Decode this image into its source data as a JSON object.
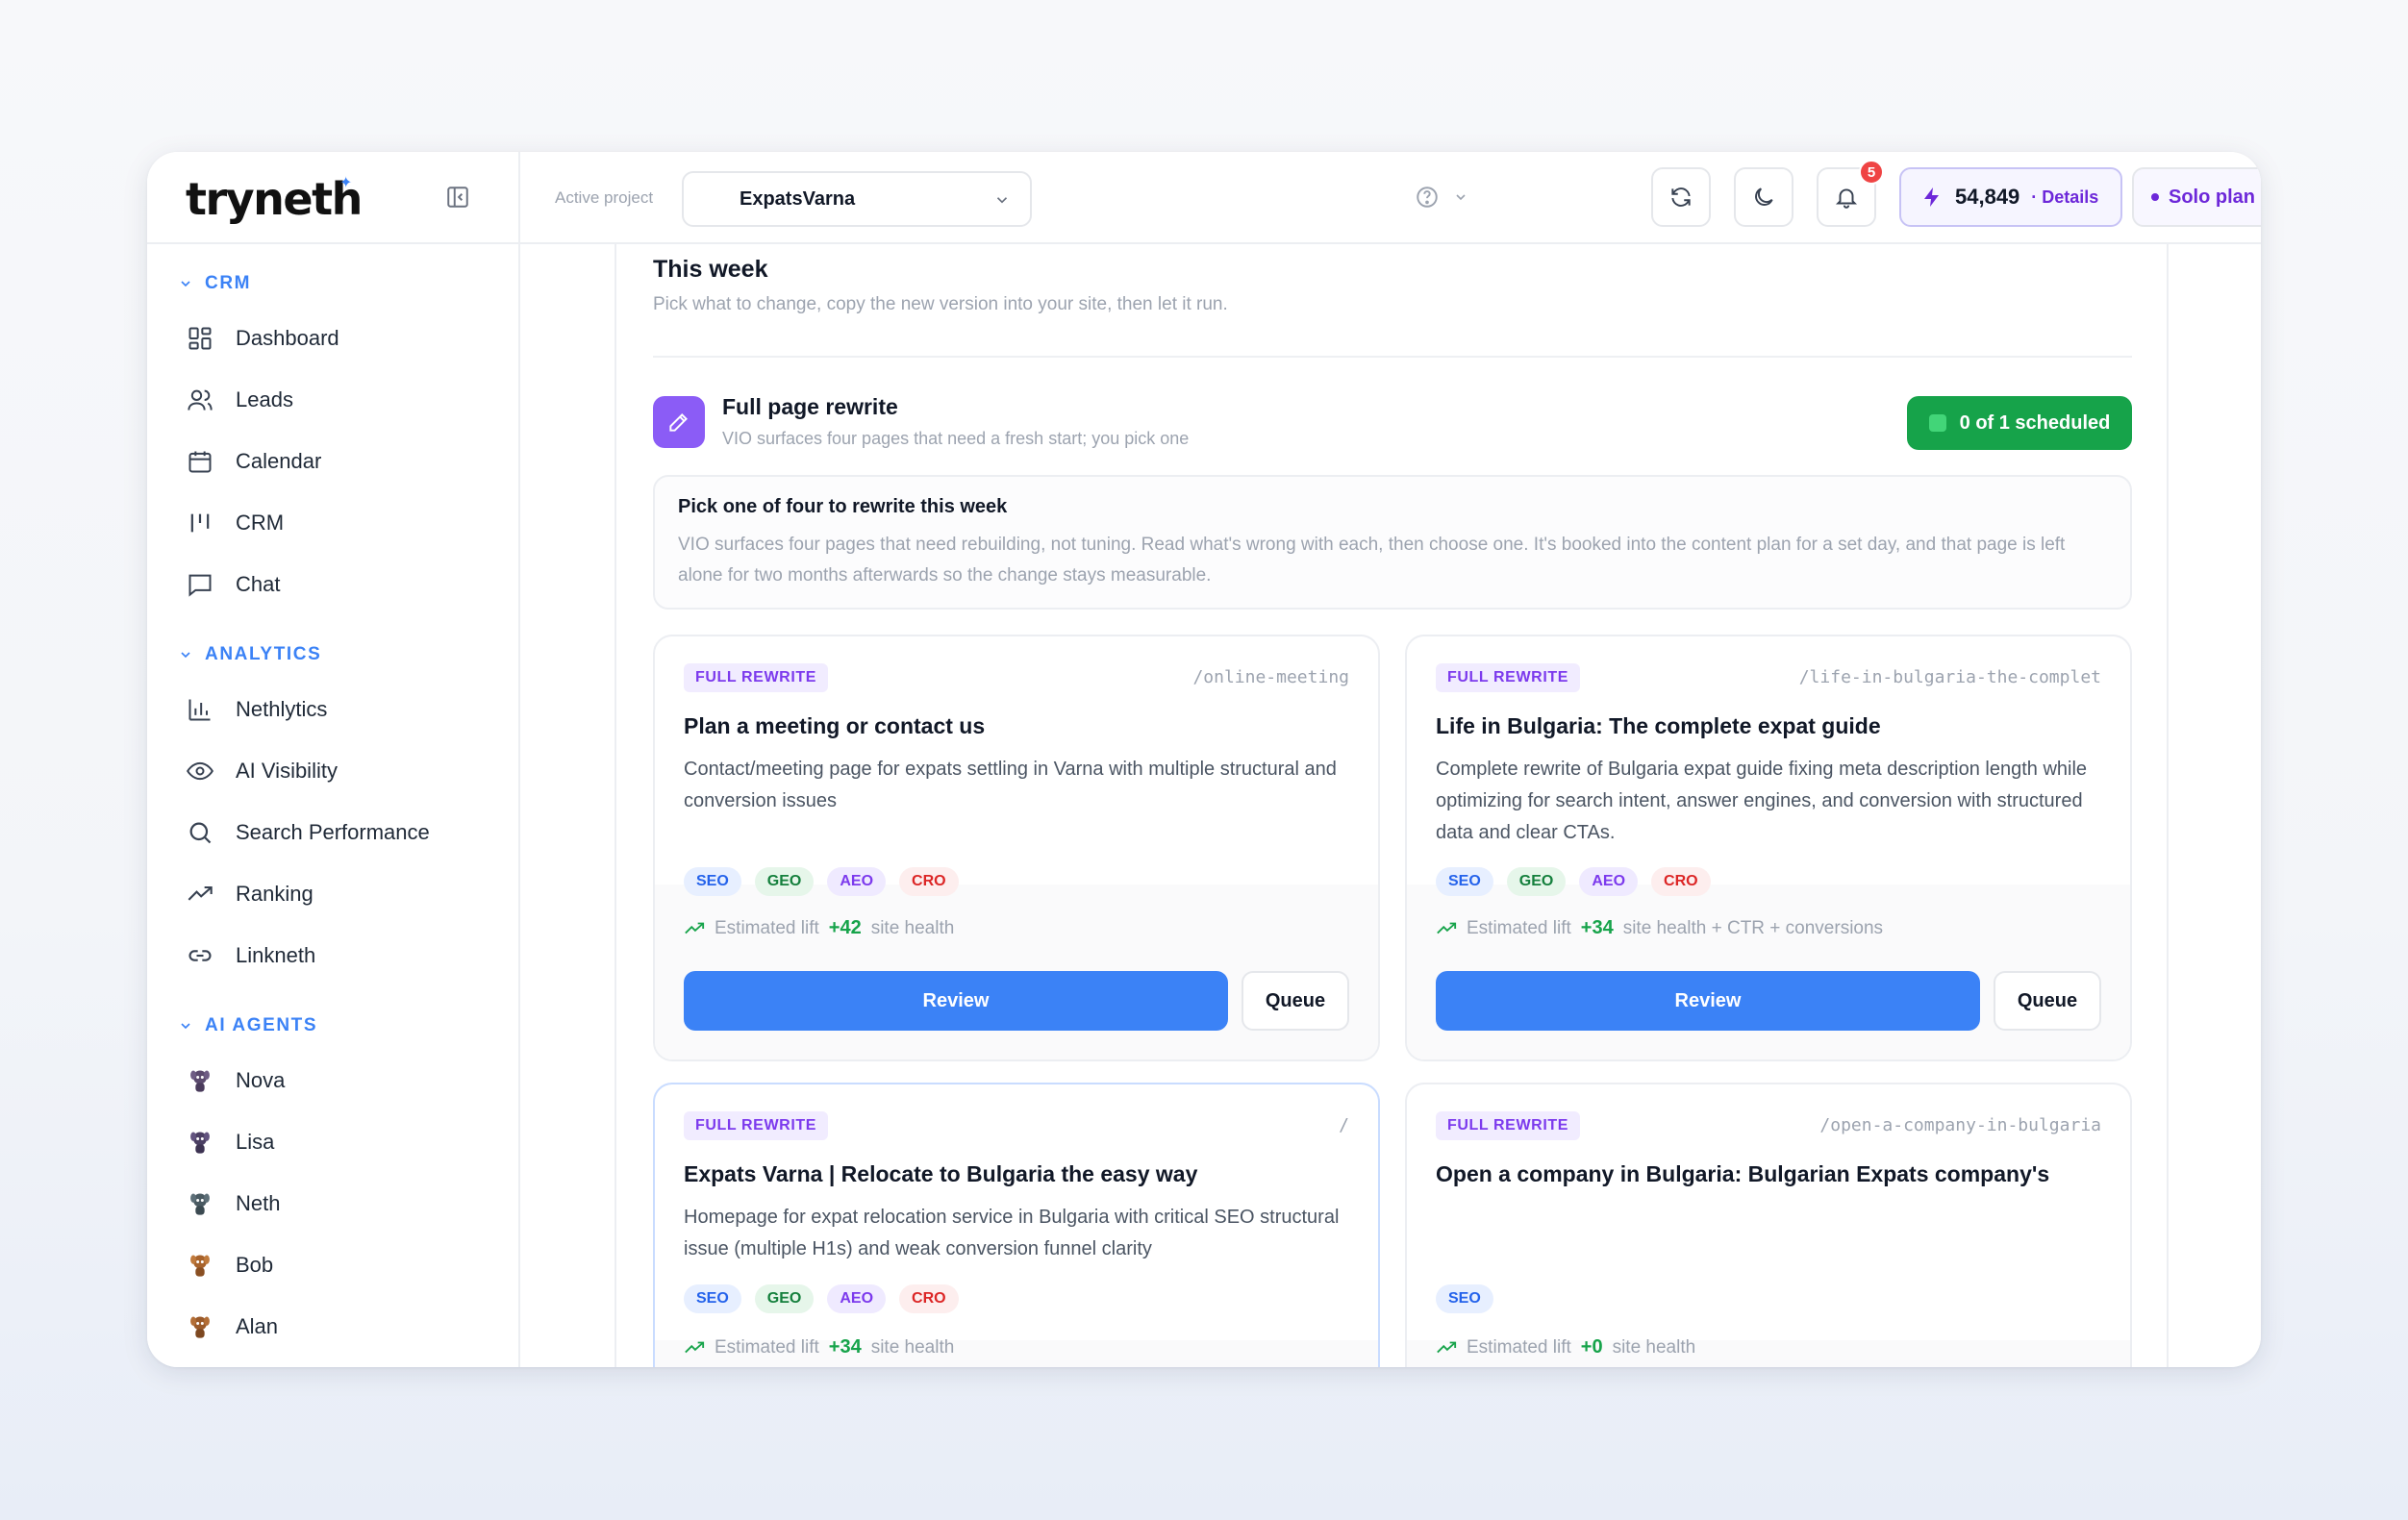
{
  "brand": {
    "name": "tryneth",
    "spark": "✦"
  },
  "sidebar": {
    "sections": [
      {
        "label": "CRM",
        "items": [
          {
            "label": "Dashboard",
            "icon": "dashboard-icon"
          },
          {
            "label": "Leads",
            "icon": "users-icon"
          },
          {
            "label": "Calendar",
            "icon": "calendar-icon"
          },
          {
            "label": "CRM",
            "icon": "kanban-icon"
          },
          {
            "label": "Chat",
            "icon": "chat-icon"
          }
        ]
      },
      {
        "label": "ANALYTICS",
        "items": [
          {
            "label": "Nethlytics",
            "icon": "bar-chart-icon"
          },
          {
            "label": "AI Visibility",
            "icon": "eye-icon"
          },
          {
            "label": "Search Performance",
            "icon": "search-icon"
          },
          {
            "label": "Ranking",
            "icon": "trending-up-icon"
          },
          {
            "label": "Linkneth",
            "icon": "link-icon"
          }
        ]
      },
      {
        "label": "AI AGENTS",
        "items": [
          {
            "label": "Nova",
            "icon": "agent-avatar-icon",
            "color": "#5b4a6e"
          },
          {
            "label": "Lisa",
            "icon": "agent-avatar-icon",
            "color": "#4b3f63"
          },
          {
            "label": "Neth",
            "icon": "agent-avatar-icon",
            "color": "#4a5a62"
          },
          {
            "label": "Bob",
            "icon": "agent-avatar-icon",
            "color": "#a8632c"
          },
          {
            "label": "Alan",
            "icon": "agent-avatar-icon",
            "color": "#9a5a2a"
          }
        ]
      }
    ]
  },
  "topbar": {
    "active_project_label": "Active project",
    "project_name": "ExpatsVarna",
    "notifications_count": "5",
    "credits": "54,849",
    "credits_details": "· Details",
    "plan": "Solo plan"
  },
  "main": {
    "week_title": "This week",
    "week_subtitle": "Pick what to change, copy the new version into your site, then let it run.",
    "rewrite_title": "Full page rewrite",
    "rewrite_subtitle": "VIO surfaces four pages that need a fresh start; you pick one",
    "scheduled_label": "0 of 1 scheduled",
    "info_title": "Pick one of four to rewrite this week",
    "info_body": "VIO surfaces four pages that need rebuilding, not tuning. Read what's wrong with each, then choose one. It's booked into the content plan for a set day, and that page is left alone for two months afterwards so the change stays measurable.",
    "cards": [
      {
        "tag": "FULL REWRITE",
        "slug": "/online-meeting",
        "title": "Plan a meeting or contact us",
        "description": "Contact/meeting page for expats settling in Varna with multiple structural and conversion issues",
        "chips": [
          "SEO",
          "GEO",
          "AEO",
          "CRO"
        ],
        "lift_label": "Estimated lift",
        "lift_value": "+42",
        "lift_suffix": "site health",
        "review_label": "Review",
        "queue_label": "Queue"
      },
      {
        "tag": "FULL REWRITE",
        "slug": "/life-in-bulgaria-the-complet",
        "title": "Life in Bulgaria: The complete expat guide",
        "description": "Complete rewrite of Bulgaria expat guide fixing meta description length while optimizing for search intent, answer engines, and conversion with structured data and clear CTAs.",
        "chips": [
          "SEO",
          "GEO",
          "AEO",
          "CRO"
        ],
        "lift_label": "Estimated lift",
        "lift_value": "+34",
        "lift_suffix": "site health + CTR + conversions",
        "review_label": "Review",
        "queue_label": "Queue"
      },
      {
        "tag": "FULL REWRITE",
        "slug": "/",
        "title": "Expats Varna | Relocate to Bulgaria the easy way",
        "description": "Homepage for expat relocation service in Bulgaria with critical SEO structural issue (multiple H1s) and weak conversion funnel clarity",
        "chips": [
          "SEO",
          "GEO",
          "AEO",
          "CRO"
        ],
        "lift_label": "Estimated lift",
        "lift_value": "+34",
        "lift_suffix": "site health"
      },
      {
        "tag": "FULL REWRITE",
        "slug": "/open-a-company-in-bulgaria",
        "title": "Open a company in Bulgaria: Bulgarian Expats company's",
        "description": "",
        "chips": [
          "SEO"
        ],
        "lift_label": "Estimated lift",
        "lift_value": "+0",
        "lift_suffix": "site health"
      }
    ]
  },
  "colors": {
    "accent": "#3b82f6",
    "purple": "#7c3aed",
    "success": "#16a34a",
    "danger": "#ef4444"
  }
}
